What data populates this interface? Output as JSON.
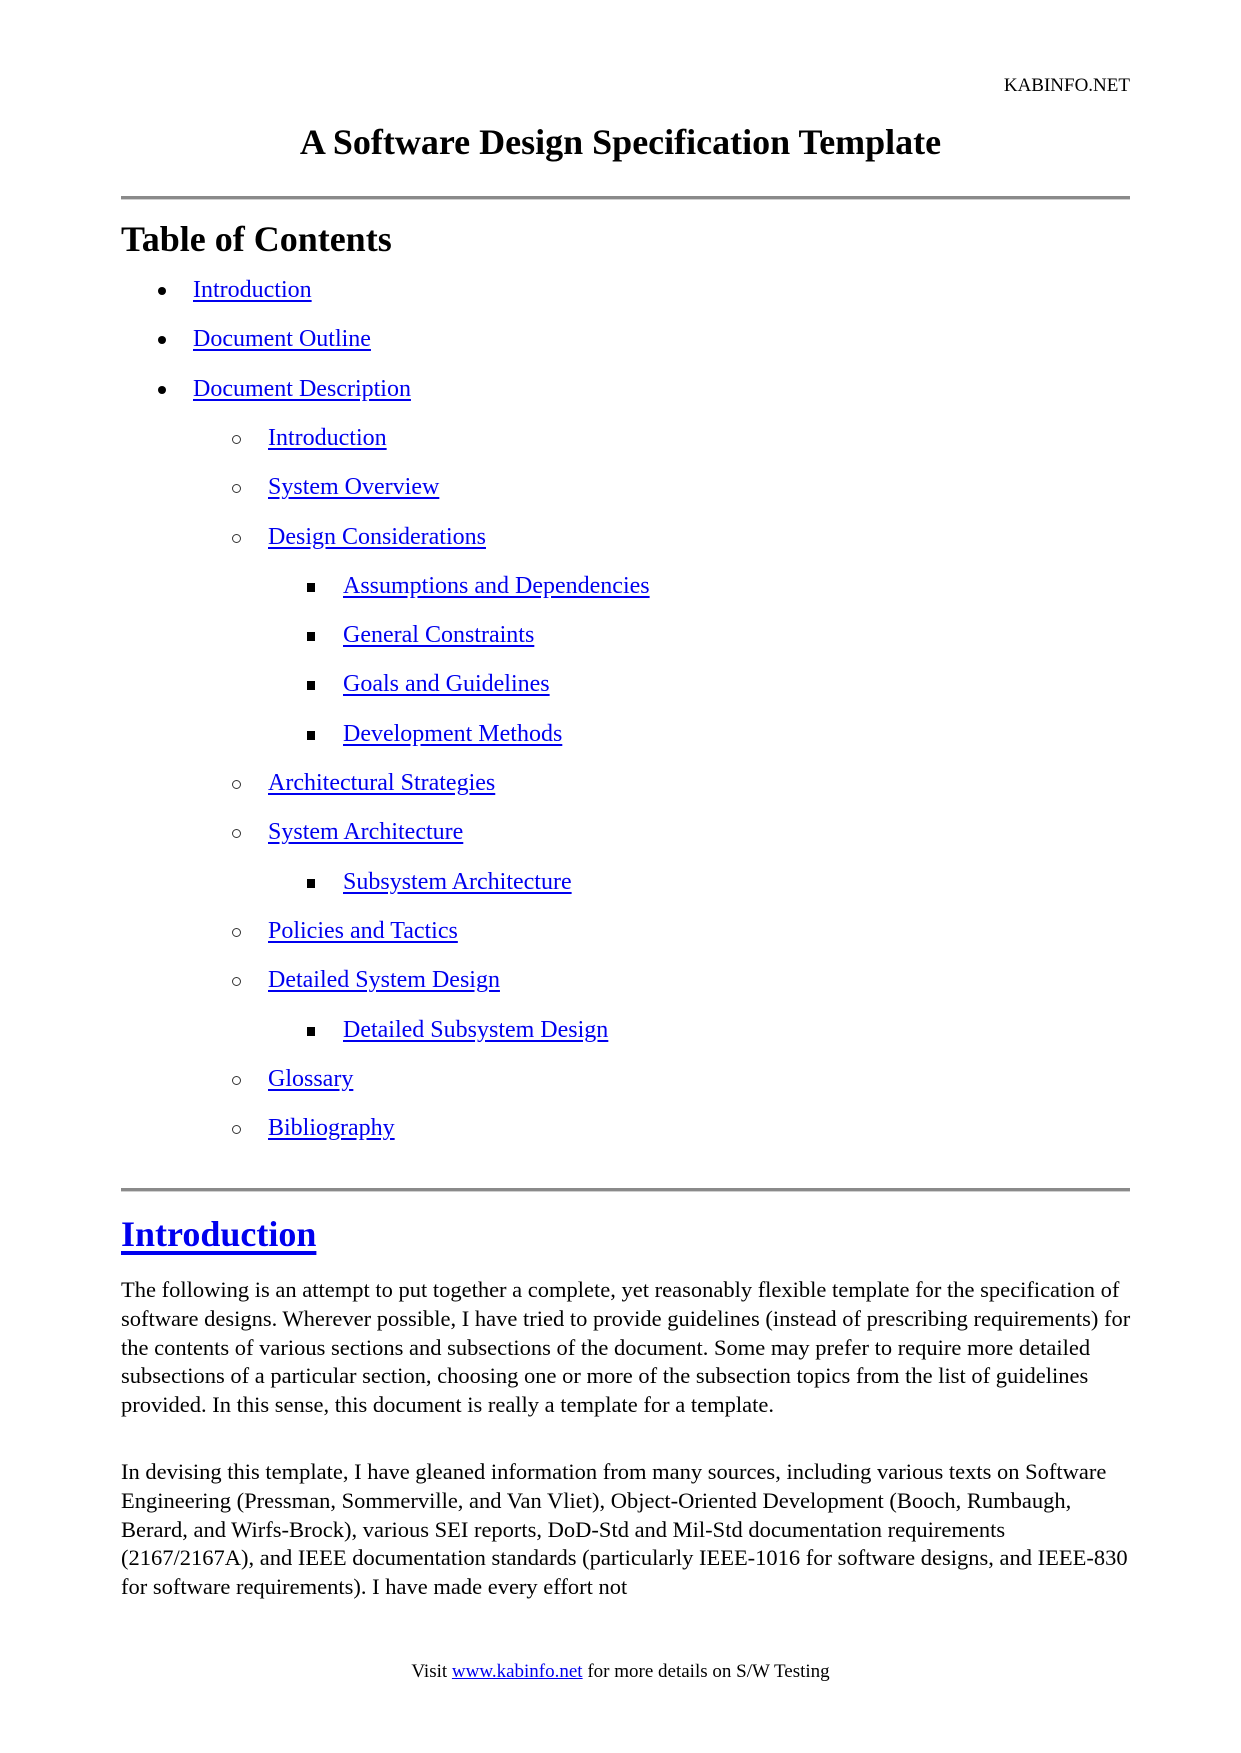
{
  "header": {
    "site": "KABINFO.NET"
  },
  "title": "A Software Design Specification Template",
  "toc": {
    "heading": "Table of Contents",
    "items": [
      {
        "label": "Introduction",
        "level": 1
      },
      {
        "label": "Document Outline",
        "level": 1
      },
      {
        "label": "Document Description",
        "level": 1
      },
      {
        "label": "Introduction",
        "level": 2
      },
      {
        "label": "System Overview",
        "level": 2
      },
      {
        "label": "Design Considerations",
        "level": 2
      },
      {
        "label": "Assumptions and Dependencies",
        "level": 3
      },
      {
        "label": "General Constraints",
        "level": 3
      },
      {
        "label": "Goals and Guidelines",
        "level": 3
      },
      {
        "label": "Development Methods",
        "level": 3
      },
      {
        "label": "Architectural Strategies",
        "level": 2
      },
      {
        "label": "System Architecture",
        "level": 2
      },
      {
        "label": "Subsystem Architecture",
        "level": 3
      },
      {
        "label": "Policies and Tactics",
        "level": 2
      },
      {
        "label": "Detailed System Design",
        "level": 2
      },
      {
        "label": "Detailed Subsystem Design",
        "level": 3
      },
      {
        "label": "Glossary",
        "level": 2
      },
      {
        "label": "Bibliography",
        "level": 2
      }
    ]
  },
  "introduction": {
    "heading": "Introduction",
    "paragraphs": [
      "The following is an attempt to put together a complete, yet reasonably flexible template for the specification of software designs. Wherever possible, I have tried to provide guidelines (instead of prescribing requirements) for the contents of various sections and subsections of the document. Some may prefer to require more detailed subsections of a particular section, choosing one or more of the subsection topics from the list of guidelines provided. In this sense, this document is really a template for a template.",
      "In devising this template, I have gleaned information from many sources, including various texts on Software Engineering (Pressman, Sommerville, and Van Vliet), Object-Oriented Development (Booch, Rumbaugh, Berard, and Wirfs-Brock), various SEI reports, DoD-Std and Mil-Std documentation requirements (2167/2167A), and IEEE documentation standards (particularly IEEE-1016 for software designs, and IEEE-830 for software requirements). I have made every effort not"
    ]
  },
  "footer": {
    "prefix": "Visit ",
    "link": "www.kabinfo.net",
    "suffix": " for more details on S/W Testing"
  },
  "colors": {
    "link": "#0000ee",
    "rule": "#8a8a8a",
    "text": "#000000"
  }
}
